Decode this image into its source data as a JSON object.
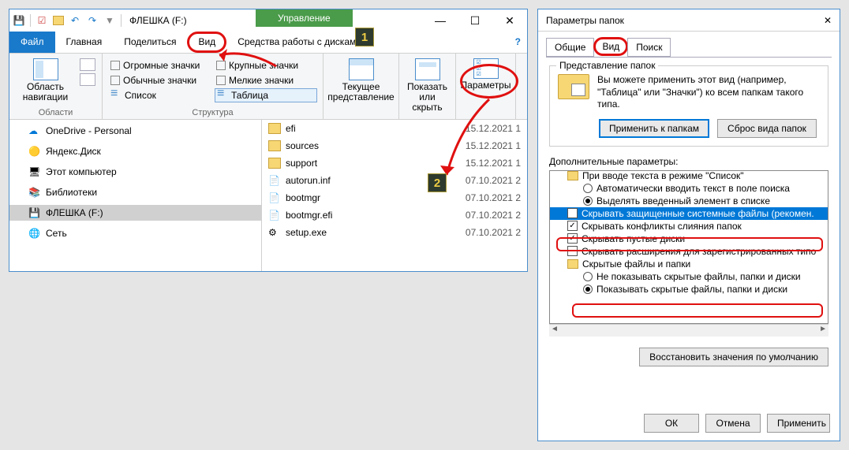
{
  "explorer": {
    "title": "ФЛЕШКА (F:)",
    "context_tab": "Управление",
    "badge1": "1",
    "badge2": "2",
    "tabs": {
      "file": "Файл",
      "home": "Главная",
      "share": "Поделиться",
      "view": "Вид",
      "drive": "Средства работы с дисками"
    },
    "ribbon": {
      "panes_group": "Области",
      "nav_pane": "Область навигации",
      "layout_group": "Структура",
      "layouts": {
        "huge": "Огромные значки",
        "large": "Крупные значки",
        "normal": "Обычные значки",
        "small": "Мелкие значки",
        "list": "Список",
        "table": "Таблица"
      },
      "curview": "Текущее представление",
      "showhide": "Показать или скрыть",
      "options": "Параметры"
    },
    "nav": {
      "onedrive": "OneDrive - Personal",
      "yandex": "Яндекс.Диск",
      "thispc": "Этот компьютер",
      "libs": "Библиотеки",
      "flash": "ФЛЕШКА (F:)",
      "network": "Сеть"
    },
    "files": [
      {
        "name": "efi",
        "date": "15.12.2021 1",
        "type": "folder"
      },
      {
        "name": "sources",
        "date": "15.12.2021 1",
        "type": "folder"
      },
      {
        "name": "support",
        "date": "15.12.2021 1",
        "type": "folder"
      },
      {
        "name": "autorun.inf",
        "date": "07.10.2021 2",
        "type": "file"
      },
      {
        "name": "bootmgr",
        "date": "07.10.2021 2",
        "type": "file"
      },
      {
        "name": "bootmgr.efi",
        "date": "07.10.2021 2",
        "type": "file"
      },
      {
        "name": "setup.exe",
        "date": "07.10.2021 2",
        "type": "file"
      }
    ]
  },
  "options": {
    "title": "Параметры папок",
    "tabs": {
      "general": "Общие",
      "view": "Вид",
      "search": "Поиск"
    },
    "folderviews": {
      "group": "Представление папок",
      "text": "Вы можете применить этот вид (например, \"Таблица\" или \"Значки\") ко всем папкам такого типа.",
      "apply": "Применить к папкам",
      "reset": "Сброс вида папок"
    },
    "advanced_label": "Дополнительные параметры:",
    "tree": {
      "i1": "При вводе текста в режиме \"Список\"",
      "i2": "Автоматически вводить текст в поле поиска",
      "i3": "Выделять введенный элемент в списке",
      "i4": "Скрывать защищенные системные файлы (рекомен.",
      "i5": "Скрывать конфликты слияния папок",
      "i6": "Скрывать пустые диски",
      "i7": "Скрывать расширения для зарегистрированных типо",
      "i8": "Скрытые файлы и папки",
      "i9": "Не показывать скрытые файлы, папки и диски",
      "i10": "Показывать скрытые файлы, папки и диски"
    },
    "restore": "Восстановить значения по умолчанию",
    "ok": "ОК",
    "cancel": "Отмена",
    "apply": "Применить"
  }
}
